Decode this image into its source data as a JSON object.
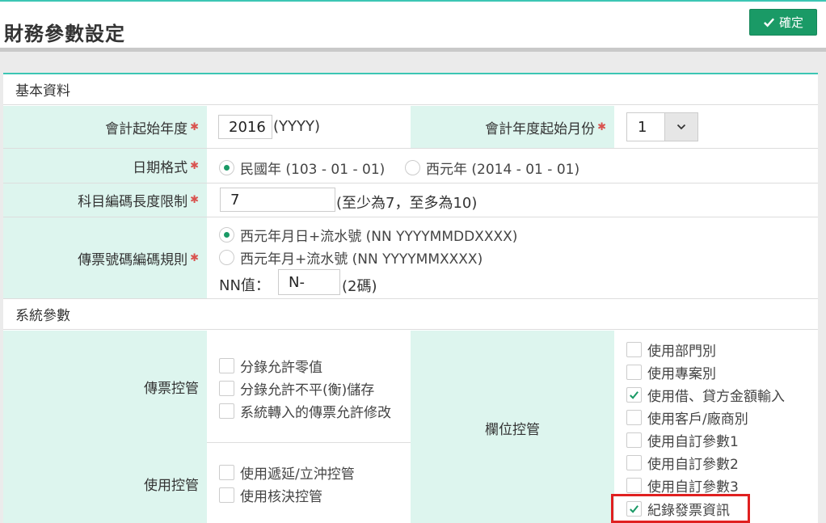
{
  "page": {
    "title": "財務參數設定"
  },
  "toolbar": {
    "confirm_label": "確定"
  },
  "basic": {
    "section_title": "基本資料",
    "fiscal_year": {
      "label": "會計起始年度",
      "value": "2016",
      "hint": "(YYYY)"
    },
    "start_month": {
      "label": "會計年度起始月份",
      "value": "1"
    },
    "date_format": {
      "label": "日期格式",
      "options": [
        "民國年 (103 - 01 - 01)",
        "西元年 (2014 - 01 - 01)"
      ],
      "selected": 0
    },
    "account_len": {
      "label": "科目編碼長度限制",
      "value": "7",
      "hint": "(至少為7，至多為10)"
    },
    "voucher_rule": {
      "label": "傳票號碼編碼規則",
      "options": [
        "西元年月日+流水號 (NN YYYYMMDDXXXX)",
        "西元年月+流水號 (NN YYYYMMXXXX)"
      ],
      "selected": 0,
      "nn_label": "NN值：",
      "nn_value": "N-",
      "nn_hint": "(2碼)"
    }
  },
  "system": {
    "section_title": "系統參數",
    "voucher_control": {
      "label": "傳票控管",
      "items": [
        {
          "label": "分錄允許零值",
          "checked": false
        },
        {
          "label": "分錄允許不平(衡)儲存",
          "checked": false
        },
        {
          "label": "系統轉入的傳票允許修改",
          "checked": false
        }
      ]
    },
    "usage_control": {
      "label": "使用控管",
      "items": [
        {
          "label": "使用遞延/立沖控管",
          "checked": false
        },
        {
          "label": "使用核決控管",
          "checked": false
        }
      ]
    },
    "field_control": {
      "label": "欄位控管",
      "items": [
        {
          "label": "使用部門別",
          "checked": false
        },
        {
          "label": "使用專案別",
          "checked": false
        },
        {
          "label": "使用借、貸方金額輸入",
          "checked": true
        },
        {
          "label": "使用客戶/廠商別",
          "checked": false
        },
        {
          "label": "使用自訂參數1",
          "checked": false
        },
        {
          "label": "使用自訂參數2",
          "checked": false
        },
        {
          "label": "使用自訂參數3",
          "checked": false
        },
        {
          "label": "紀錄發票資訊",
          "checked": true
        }
      ]
    }
  },
  "colors": {
    "accent": "#3cc6b4",
    "brand_green": "#1a9a66",
    "label_bg": "#ddf5ee",
    "highlight": "#e02020"
  },
  "icons": {
    "confirm": "check-icon",
    "select": "chevron-down-icon",
    "required": "asterisk-icon"
  }
}
